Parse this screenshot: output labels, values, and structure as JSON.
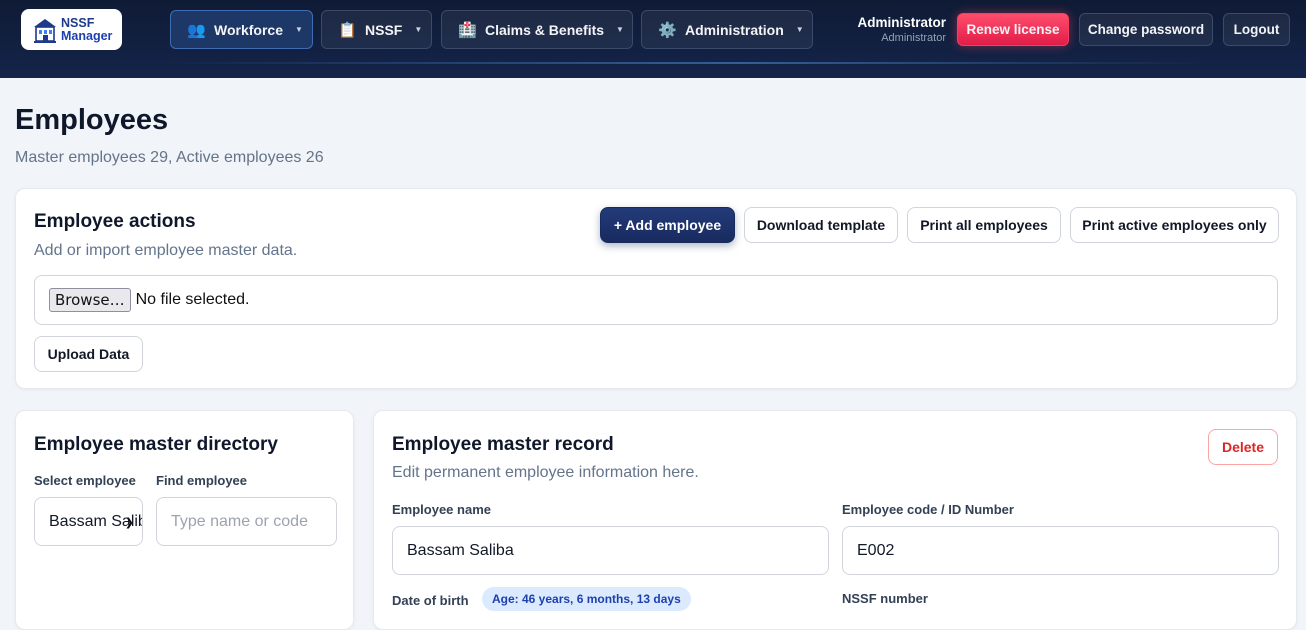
{
  "brand": {
    "line1": "NSSF",
    "line2": "Manager"
  },
  "nav": {
    "items": [
      {
        "label": "Workforce",
        "icon": "people-icon"
      },
      {
        "label": "NSSF",
        "icon": "clipboard-icon"
      },
      {
        "label": "Claims & Benefits",
        "icon": "hospital-icon"
      },
      {
        "label": "Administration",
        "icon": "gear-icon"
      }
    ]
  },
  "user": {
    "name": "Administrator",
    "role": "Administrator"
  },
  "top_actions": {
    "renew": "Renew license",
    "change_password": "Change password",
    "logout": "Logout"
  },
  "page": {
    "title": "Employees",
    "subtitle": "Master employees 29, Active employees 26"
  },
  "actions_card": {
    "title": "Employee actions",
    "desc": "Add or import employee master data.",
    "add": "+ Add employee",
    "download": "Download template",
    "print_all": "Print all employees",
    "print_active": "Print active employees only",
    "browse": "Browse…",
    "no_file": "No file selected.",
    "upload": "Upload Data"
  },
  "directory": {
    "title": "Employee master directory",
    "select_label": "Select employee",
    "select_value": "Bassam Saliba",
    "find_label": "Find employee",
    "find_placeholder": "Type name or code"
  },
  "record": {
    "title": "Employee master record",
    "desc": "Edit permanent employee information here.",
    "delete": "Delete",
    "name_label": "Employee name",
    "name_value": "Bassam Saliba",
    "code_label": "Employee code / ID Number",
    "code_value": "E002",
    "dob_label": "Date of birth",
    "age_badge": "Age: 46 years, 6 months, 13 days",
    "nssf_label": "NSSF number"
  },
  "colors": {
    "nav_bg": "#0f1b35",
    "primary": "#182b5f",
    "danger": "#e11d48",
    "badge_bg": "#dbeafe"
  }
}
